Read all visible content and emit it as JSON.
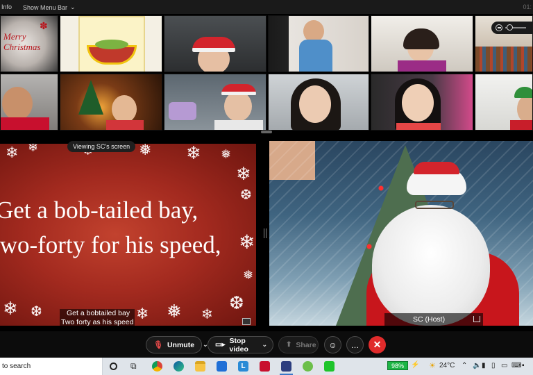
{
  "topbar": {
    "info": "Info",
    "show_menu": "Show Menu Bar",
    "clock": "01:"
  },
  "gallery": {
    "tiles": [
      {
        "label": "Merry Christmas"
      },
      {
        "label": ""
      },
      {
        "label": ""
      },
      {
        "label": ""
      },
      {
        "label": ""
      },
      {
        "label": ""
      },
      {
        "label": ""
      },
      {
        "label": ""
      },
      {
        "label": ""
      },
      {
        "label": ""
      },
      {
        "label": ""
      },
      {
        "label": ""
      }
    ]
  },
  "share": {
    "viewing_label": "Viewing SC's screen",
    "lyric_line1": "Get a bob-tailed bay,",
    "lyric_line2": "two-forty for his speed,",
    "caption_line1": "Get a bobtailed bay",
    "caption_line2": "Two forty as his speed"
  },
  "host": {
    "name": "SC (Host)"
  },
  "controls": {
    "unmute": "Unmute",
    "stop_video": "Stop video",
    "share": "Share",
    "more": "…",
    "leave": "✕"
  },
  "taskbar": {
    "search_text": "to search",
    "battery": "98%",
    "temperature": "24°C"
  },
  "colors": {
    "accent_red": "#e02b2b",
    "battery_green": "#1db546",
    "slide_red": "#a32a1f"
  }
}
